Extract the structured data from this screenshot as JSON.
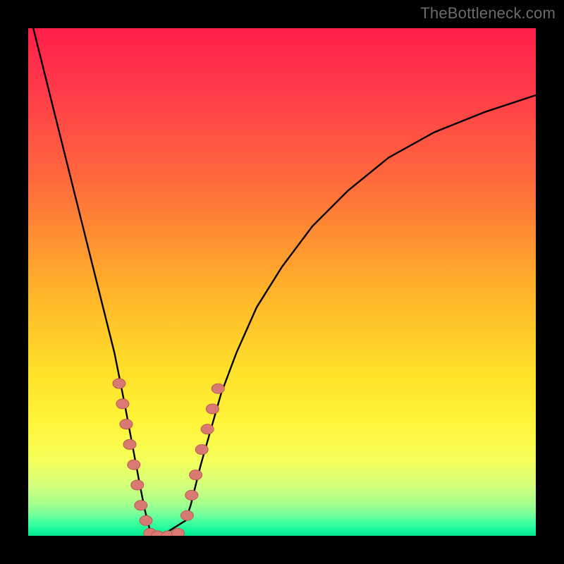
{
  "watermark": "TheBottleneck.com",
  "chart_data": {
    "type": "line",
    "title": "",
    "xlabel": "",
    "ylabel": "",
    "xlim": [
      0,
      100
    ],
    "ylim": [
      0,
      100
    ],
    "grid": false,
    "legend": false,
    "gradient_stops": [
      {
        "offset": 0.0,
        "color": "#ff1f4a"
      },
      {
        "offset": 0.12,
        "color": "#ff3a4a"
      },
      {
        "offset": 0.3,
        "color": "#ff6a3c"
      },
      {
        "offset": 0.5,
        "color": "#ffad2a"
      },
      {
        "offset": 0.68,
        "color": "#ffe22a"
      },
      {
        "offset": 0.78,
        "color": "#fff53a"
      },
      {
        "offset": 0.85,
        "color": "#f6ff5a"
      },
      {
        "offset": 0.9,
        "color": "#d4ff7a"
      },
      {
        "offset": 0.935,
        "color": "#a8ff8c"
      },
      {
        "offset": 0.958,
        "color": "#74ff9a"
      },
      {
        "offset": 0.975,
        "color": "#3effa0"
      },
      {
        "offset": 0.99,
        "color": "#13f59a"
      },
      {
        "offset": 1.0,
        "color": "#05e58f"
      }
    ],
    "green_band": {
      "y_start": 97.5,
      "y_end": 100
    },
    "series": [
      {
        "name": "bottleneck-curve",
        "x": [
          1,
          3,
          5,
          7,
          9,
          11,
          13,
          15,
          17,
          19,
          20.5,
          22,
          23,
          24,
          25,
          26,
          27,
          31,
          32,
          33,
          34,
          36,
          38,
          41,
          45,
          50,
          56,
          63,
          71,
          80,
          90,
          100
        ],
        "y": [
          100,
          92,
          84,
          76,
          68,
          60,
          52,
          44,
          36,
          26,
          18,
          10,
          5,
          1,
          0,
          0,
          0.5,
          3,
          6,
          10,
          14,
          21,
          28,
          36,
          45,
          53,
          61,
          68,
          74.5,
          79.5,
          83.5,
          86.8
        ]
      }
    ],
    "scatter_points": {
      "name": "highlight-dots",
      "points": [
        {
          "x": 17.9,
          "y": 30
        },
        {
          "x": 18.6,
          "y": 26
        },
        {
          "x": 19.3,
          "y": 22
        },
        {
          "x": 20.0,
          "y": 18
        },
        {
          "x": 20.8,
          "y": 14
        },
        {
          "x": 21.5,
          "y": 10
        },
        {
          "x": 22.2,
          "y": 6
        },
        {
          "x": 23.2,
          "y": 3
        },
        {
          "x": 24.0,
          "y": 0.5
        },
        {
          "x": 25.5,
          "y": 0
        },
        {
          "x": 27.5,
          "y": 0
        },
        {
          "x": 29.5,
          "y": 0.5
        },
        {
          "x": 31.3,
          "y": 4
        },
        {
          "x": 32.2,
          "y": 8
        },
        {
          "x": 33.0,
          "y": 12
        },
        {
          "x": 34.2,
          "y": 17
        },
        {
          "x": 35.3,
          "y": 21
        },
        {
          "x": 36.3,
          "y": 25
        },
        {
          "x": 37.4,
          "y": 29
        }
      ]
    }
  }
}
